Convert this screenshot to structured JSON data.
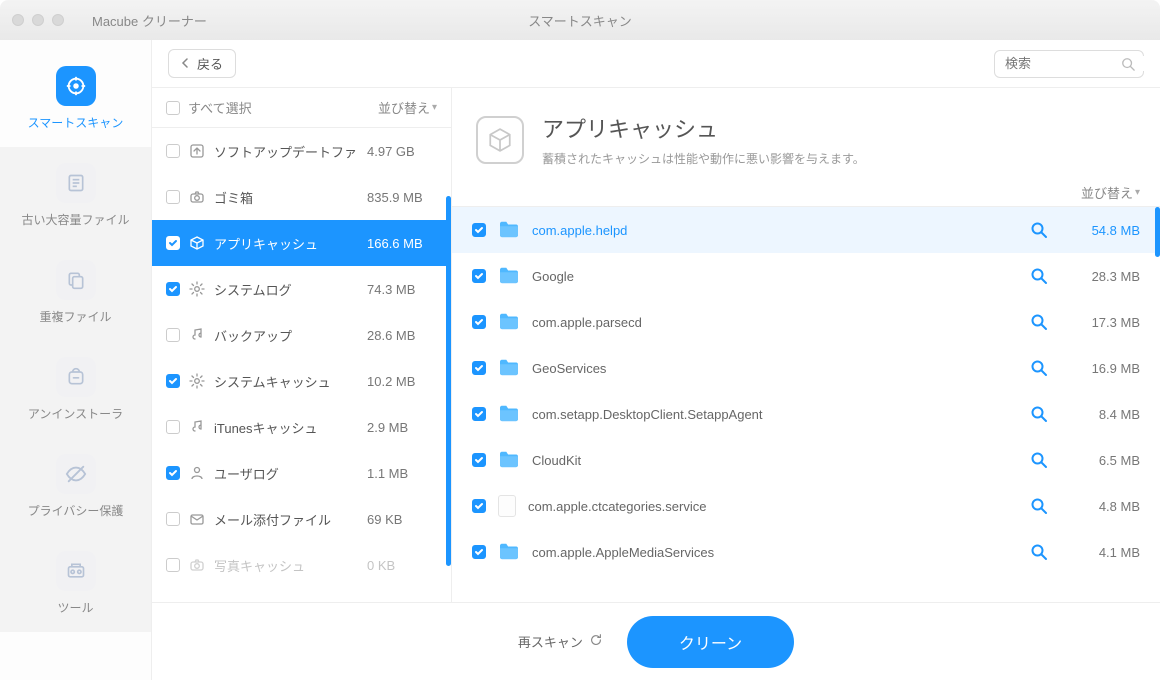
{
  "app_title": "Macube クリーナー",
  "window_title": "スマートスキャン",
  "back_label": "戻る",
  "search_placeholder": "検索",
  "select_all_label": "すべて選択",
  "sort_label": "並び替え",
  "sidebar": [
    {
      "id": "smart-scan",
      "label": "スマートスキャン",
      "active": true
    },
    {
      "id": "large-old",
      "label": "古い大容量ファイル",
      "active": false
    },
    {
      "id": "duplicate",
      "label": "重複ファイル",
      "active": false
    },
    {
      "id": "uninstaller",
      "label": "アンインストーラ",
      "active": false
    },
    {
      "id": "privacy",
      "label": "プライバシー保護",
      "active": false
    },
    {
      "id": "tools",
      "label": "ツール",
      "active": false
    }
  ],
  "categories": [
    {
      "id": "software-update",
      "label": "ソフトアップデートファ",
      "size": "4.97 GB",
      "checked": false,
      "selected": false,
      "icon": "arrow-up-box"
    },
    {
      "id": "trash",
      "label": "ゴミ箱",
      "size": "835.9 MB",
      "checked": false,
      "selected": false,
      "icon": "camera"
    },
    {
      "id": "app-cache",
      "label": "アプリキャッシュ",
      "size": "166.6 MB",
      "checked": true,
      "selected": true,
      "icon": "box-3d"
    },
    {
      "id": "system-log",
      "label": "システムログ",
      "size": "74.3 MB",
      "checked": true,
      "selected": false,
      "icon": "gear"
    },
    {
      "id": "backup",
      "label": "バックアップ",
      "size": "28.6 MB",
      "checked": false,
      "selected": false,
      "icon": "music-note"
    },
    {
      "id": "system-cache",
      "label": "システムキャッシュ",
      "size": "10.2 MB",
      "checked": true,
      "selected": false,
      "icon": "gear"
    },
    {
      "id": "itunes-cache",
      "label": "iTunesキャッシュ",
      "size": "2.9 MB",
      "checked": false,
      "selected": false,
      "icon": "music-note"
    },
    {
      "id": "user-log",
      "label": "ユーザログ",
      "size": "1.1 MB",
      "checked": true,
      "selected": false,
      "icon": "person"
    },
    {
      "id": "mail-attachments",
      "label": "メール添付ファイル",
      "size": "69 KB",
      "checked": false,
      "selected": false,
      "icon": "envelope"
    },
    {
      "id": "photo-cache",
      "label": "写真キャッシュ",
      "size": "0 KB",
      "checked": false,
      "selected": false,
      "icon": "camera",
      "disabled": true
    }
  ],
  "detail_header": {
    "title": "アプリキャッシュ",
    "subtitle": "蓄積されたキャッシュは性能や動作に悪い影響を与えます。"
  },
  "detail_items": [
    {
      "name": "com.apple.helpd",
      "size": "54.8 MB",
      "checked": true,
      "selected": true,
      "icon": "folder"
    },
    {
      "name": "Google",
      "size": "28.3 MB",
      "checked": true,
      "selected": false,
      "icon": "folder"
    },
    {
      "name": "com.apple.parsecd",
      "size": "17.3 MB",
      "checked": true,
      "selected": false,
      "icon": "folder"
    },
    {
      "name": "GeoServices",
      "size": "16.9 MB",
      "checked": true,
      "selected": false,
      "icon": "folder"
    },
    {
      "name": "com.setapp.DesktopClient.SetappAgent",
      "size": "8.4 MB",
      "checked": true,
      "selected": false,
      "icon": "folder"
    },
    {
      "name": "CloudKit",
      "size": "6.5 MB",
      "checked": true,
      "selected": false,
      "icon": "folder"
    },
    {
      "name": "com.apple.ctcategories.service",
      "size": "4.8 MB",
      "checked": true,
      "selected": false,
      "icon": "file"
    },
    {
      "name": "com.apple.AppleMediaServices",
      "size": "4.1 MB",
      "checked": true,
      "selected": false,
      "icon": "folder"
    }
  ],
  "rescan_label": "再スキャン",
  "clean_label": "クリーン",
  "colors": {
    "accent": "#1C95FF"
  }
}
